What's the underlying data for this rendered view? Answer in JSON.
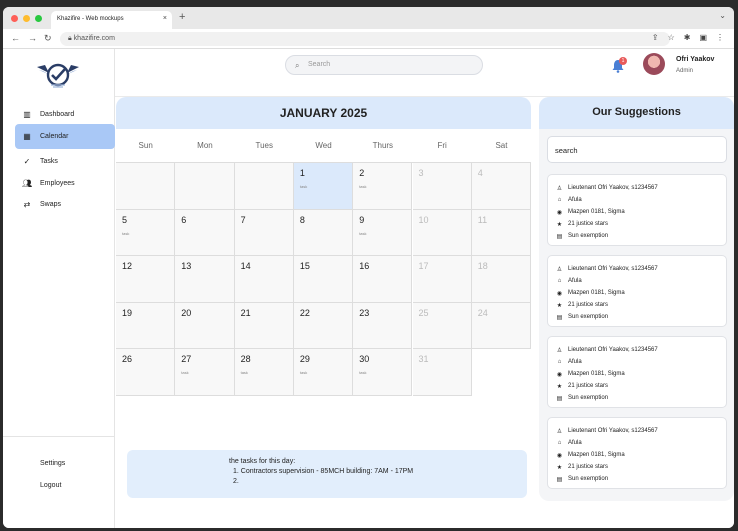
{
  "browser": {
    "tab_title": "Khazifire - Web mockups",
    "tab_close": "×",
    "new_tab": "+",
    "url": "khazifire.com",
    "dot_colors": [
      "#fe5f57",
      "#febc2e",
      "#28c840"
    ]
  },
  "sidebar": {
    "items": [
      {
        "label": "Dashboard",
        "icon": "bar-chart-icon"
      },
      {
        "label": "Calendar",
        "icon": "calendar-icon"
      },
      {
        "label": "Tasks",
        "icon": "tasks-icon"
      },
      {
        "label": "Employees",
        "icon": "people-icon"
      },
      {
        "label": "Swaps",
        "icon": "swap-icon"
      }
    ],
    "active": "Calendar",
    "settings": "Settings",
    "logout": "Logout"
  },
  "header": {
    "search_placeholder": "Search",
    "notification_count": "1",
    "user_name": "Ofri Yaakov",
    "user_role": "Admin"
  },
  "calendar": {
    "title": "JANUARY 2025",
    "weekdays": [
      "Sun",
      "Mon",
      "Tues",
      "Wed",
      "Thurs",
      "Fri",
      "Sat"
    ],
    "weeks": [
      [
        null,
        null,
        null,
        {
          "day": "1",
          "task": "task",
          "highlight": true
        },
        {
          "day": "2",
          "task": "task"
        },
        {
          "day": "3",
          "muted": true
        },
        {
          "day": "4",
          "muted": true
        }
      ],
      [
        {
          "day": "5",
          "task": "task"
        },
        {
          "day": "6"
        },
        {
          "day": "7"
        },
        {
          "day": "8"
        },
        {
          "day": "9",
          "task": "task"
        },
        {
          "day": "10",
          "muted": true
        },
        {
          "day": "11",
          "muted": true
        }
      ],
      [
        {
          "day": "12"
        },
        {
          "day": "13"
        },
        {
          "day": "14"
        },
        {
          "day": "15"
        },
        {
          "day": "16"
        },
        {
          "day": "17",
          "muted": true
        },
        {
          "day": "18",
          "muted": true
        }
      ],
      [
        {
          "day": "19"
        },
        {
          "day": "20"
        },
        {
          "day": "21"
        },
        {
          "day": "22"
        },
        {
          "day": "23"
        },
        {
          "day": "25",
          "muted": true
        },
        {
          "day": "24",
          "muted": true
        }
      ],
      [
        {
          "day": "26"
        },
        {
          "day": "27",
          "task": "task"
        },
        {
          "day": "28",
          "task": "task"
        },
        {
          "day": "29",
          "task": "task"
        },
        {
          "day": "30",
          "task": "task"
        },
        {
          "day": "31",
          "muted": true
        },
        null
      ]
    ]
  },
  "tasks_box": {
    "heading": "the tasks for this day:",
    "items": [
      "1.  Contractors supervision - 85MCH building: 7AM - 17PM",
      "2."
    ]
  },
  "suggestions": {
    "title": "Our Suggestions",
    "search_value": "search",
    "cards": [
      {
        "name": "Lieutenant Ofri Yaakov, s1234567",
        "city": "Afula",
        "unit": "Mazpen 0181, Sigma",
        "stars": "21 justice stars",
        "exemption": "Sun exemption"
      },
      {
        "name": "Lieutenant Ofri Yaakov, s1234567",
        "city": "Afula",
        "unit": "Mazpen 0181, Sigma",
        "stars": "21 justice stars",
        "exemption": "Sun exemption"
      },
      {
        "name": "Lieutenant Ofri Yaakov, s1234567",
        "city": "Afula",
        "unit": "Mazpen 0181, Sigma",
        "stars": "21 justice stars",
        "exemption": "Sun exemption"
      },
      {
        "name": "Lieutenant Ofri Yaakov, s1234567",
        "city": "Afula",
        "unit": "Mazpen 0181, Sigma",
        "stars": "21 justice stars",
        "exemption": "Sun exemption"
      }
    ]
  },
  "colors": {
    "accent": "#a9c8f6",
    "header_bg": "#dbe9fb",
    "badge": "#e85a5a"
  }
}
